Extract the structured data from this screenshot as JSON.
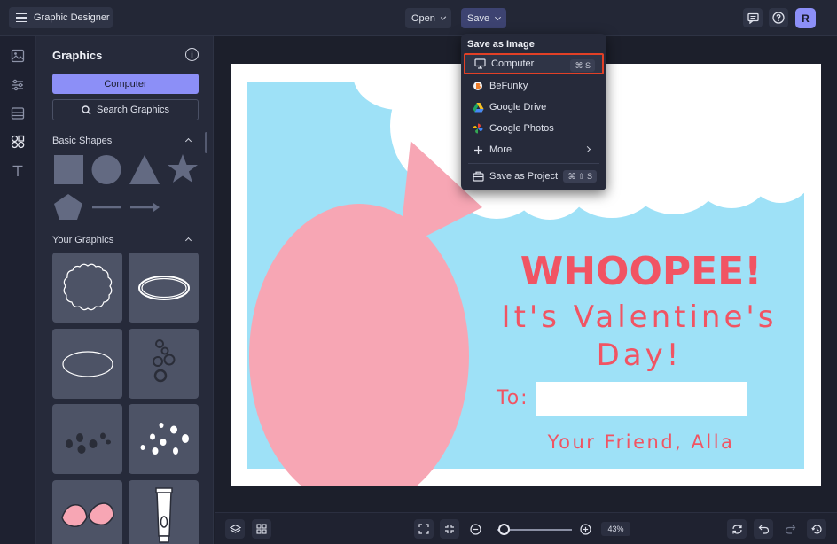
{
  "app": {
    "title": "Graphic Designer",
    "user_initial": "R"
  },
  "toolbar": {
    "open_label": "Open",
    "save_label": "Save"
  },
  "panel": {
    "title": "Graphics",
    "computer_label": "Computer",
    "search_label": "Search Graphics",
    "basic_shapes_label": "Basic Shapes",
    "your_graphics_label": "Your Graphics"
  },
  "save_menu": {
    "header": "Save as Image",
    "items": [
      {
        "label": "Computer",
        "shortcut": "⌘ S",
        "icon": "monitor-icon"
      },
      {
        "label": "BeFunky",
        "shortcut": "",
        "icon": "befunky-logo-icon"
      },
      {
        "label": "Google Drive",
        "shortcut": "",
        "icon": "google-drive-icon"
      },
      {
        "label": "Google Photos",
        "shortcut": "",
        "icon": "google-photos-icon"
      },
      {
        "label": "More",
        "shortcut": "",
        "icon": "plus-icon"
      },
      {
        "label": "Save as Project",
        "shortcut": "⌘ ⇧ S",
        "icon": "project-icon"
      }
    ]
  },
  "card": {
    "headline": "WHOOPEE!",
    "line1": "It's Valentine's",
    "line2": "Day!",
    "to_label": "To:",
    "signature": "Your Friend, Alla"
  },
  "zoom": {
    "value": "43%",
    "level": 0.1
  },
  "colors": {
    "accent": "#8c8ff7",
    "card_blue": "#9ee1f7",
    "card_pink": "#f7a6b4",
    "headline_red": "#f15463",
    "selection_outline": "#e24026"
  }
}
